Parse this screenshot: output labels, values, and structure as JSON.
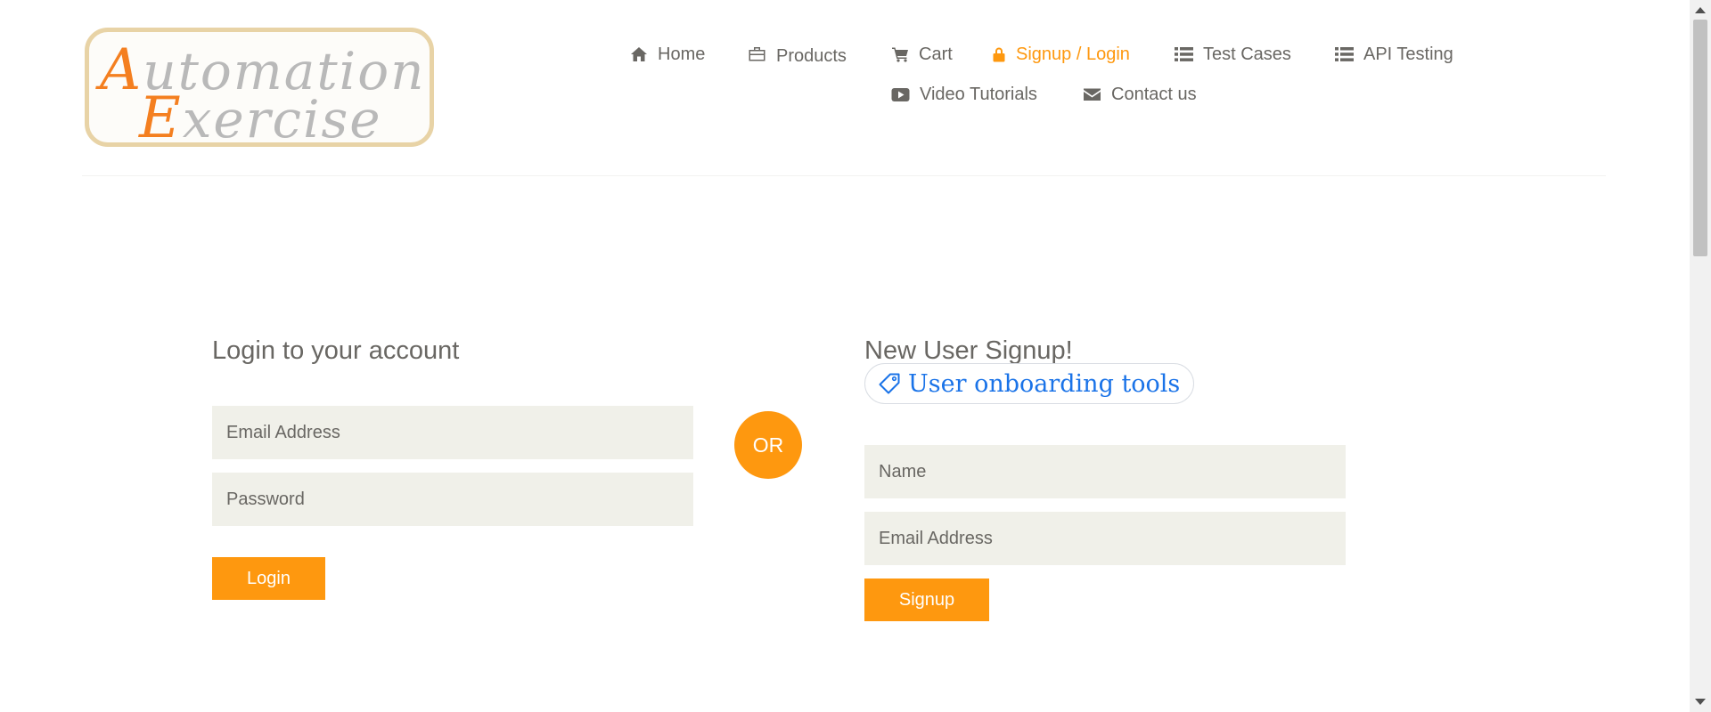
{
  "logo": {
    "line1_cap": "A",
    "line1_rest": "utomation",
    "line2_cap": "E",
    "line2_rest": "xercise"
  },
  "nav": {
    "items": [
      {
        "label": "Home",
        "icon": "home-icon"
      },
      {
        "label": "Products",
        "icon": "briefcase-icon"
      },
      {
        "label": "Cart",
        "icon": "cart-icon"
      },
      {
        "label": "Signup / Login",
        "icon": "lock-icon",
        "active": true
      },
      {
        "label": "Test Cases",
        "icon": "list-icon"
      },
      {
        "label": "API Testing",
        "icon": "list-icon"
      },
      {
        "label": "Video Tutorials",
        "icon": "youtube-play-icon"
      },
      {
        "label": "Contact us",
        "icon": "envelope-icon"
      }
    ]
  },
  "login": {
    "title": "Login to your account",
    "email_placeholder": "Email Address",
    "password_placeholder": "Password",
    "button": "Login"
  },
  "separator": "OR",
  "signup": {
    "title": "New User Signup!",
    "chip_label": "User onboarding tools",
    "chip_icon": "tag-icon",
    "name_placeholder": "Name",
    "email_placeholder": "Email Address",
    "button": "Signup"
  },
  "colors": {
    "accent": "#fe980f",
    "text": "#696763",
    "input_bg": "#f0f0e9",
    "chip_text": "#1a73e8"
  }
}
